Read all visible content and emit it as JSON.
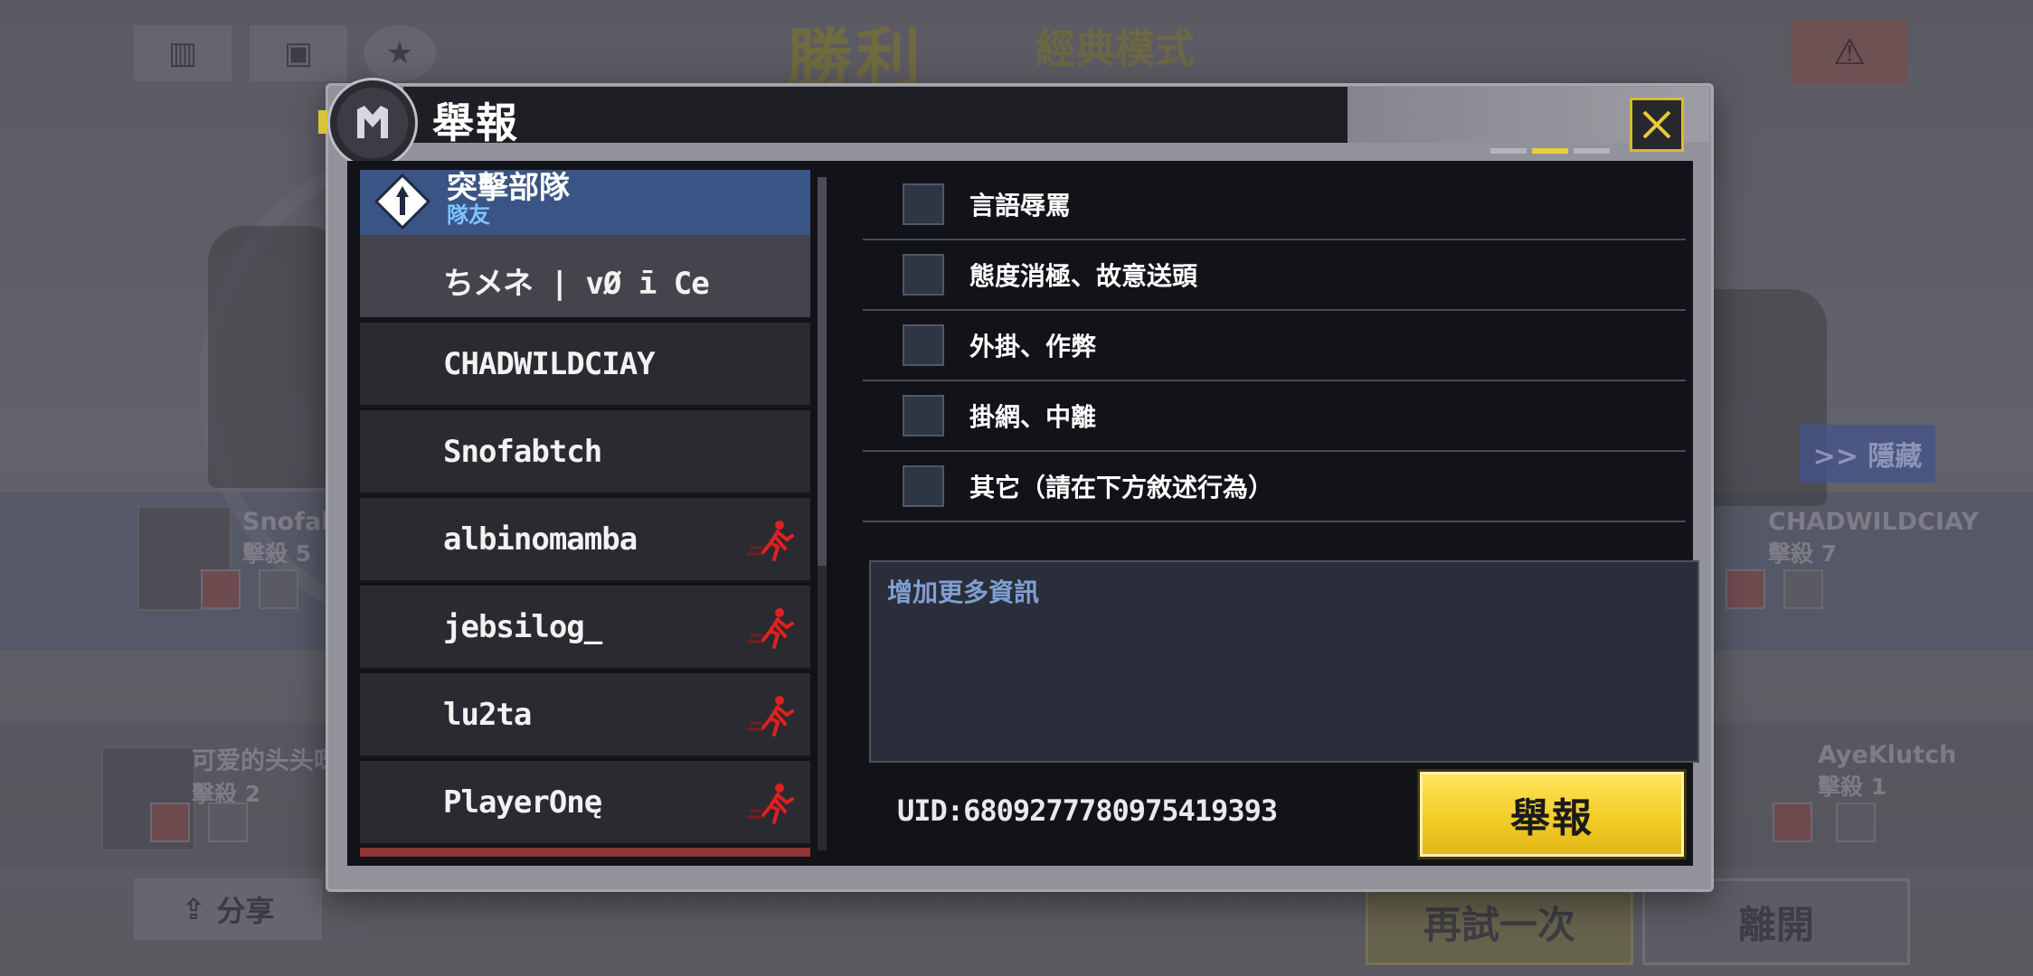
{
  "background": {
    "title": "勝利",
    "subtitle": "經典模式",
    "hide_label": ">> 隱藏",
    "share_label": "分享",
    "retry_label": "再試一次",
    "leave_label": "離開",
    "cards": [
      {
        "name": "Snofabtch",
        "kills": "擊殺 5"
      },
      {
        "name": "CHADWILDCIAY",
        "kills": "擊殺 7"
      },
      {
        "name": "可爱的头头呀",
        "kills": "擊殺 2"
      },
      {
        "name": "AyeKlutch",
        "kills": "擊殺 1"
      }
    ]
  },
  "modal": {
    "title": "舉報",
    "team": {
      "name": "突擊部隊",
      "role": "隊友"
    },
    "players": [
      {
        "name": "ちメネ | vØ ī Ce",
        "left_match": false,
        "selected": true
      },
      {
        "name": "CHADWILDCIAY",
        "left_match": false,
        "selected": false
      },
      {
        "name": "Snofabtch",
        "left_match": false,
        "selected": false
      },
      {
        "name": "albinomamba",
        "left_match": true,
        "selected": false
      },
      {
        "name": "jebsilog_",
        "left_match": true,
        "selected": false
      },
      {
        "name": "lu2ta",
        "left_match": true,
        "selected": false
      },
      {
        "name": "PlayerOnę",
        "left_match": true,
        "selected": false
      }
    ],
    "reasons": [
      {
        "label": "言語辱罵",
        "checked": false
      },
      {
        "label": "態度消極、故意送頭",
        "checked": false
      },
      {
        "label": "外掛、作弊",
        "checked": false
      },
      {
        "label": "掛網、中離",
        "checked": false
      },
      {
        "label": "其它（請在下方敘述行為）",
        "checked": false
      }
    ],
    "info_placeholder": "增加更多資訊",
    "uid": "UID:6809277780975419393",
    "report_label": "舉報",
    "colors": {
      "accent": "#f3cd27",
      "team_header": "#3a5585",
      "left_icon": "#e02020"
    }
  }
}
